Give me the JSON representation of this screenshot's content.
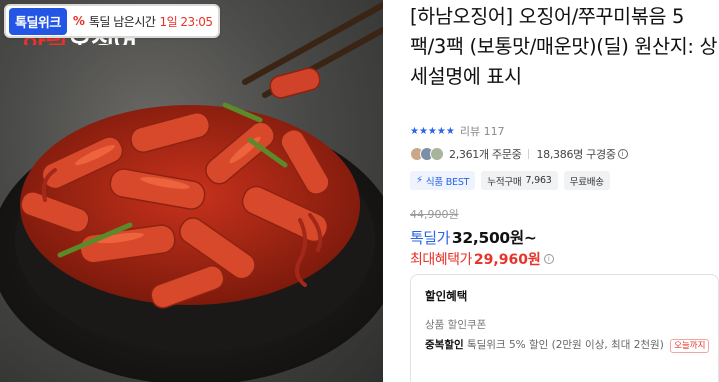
{
  "deal_banner": {
    "badge": "톡딜위크",
    "label": "톡딜 남은시간",
    "time": "1일 23:05",
    "percent_icon": "percent-icon"
  },
  "image_peek_text": {
    "red": "하남",
    "white": "오징어"
  },
  "product": {
    "title": "[하남오징어] 오징어/쭈꾸미볶음 5팩/3팩 (보통맛/매운맛)(딜) 원산지: 상세설명에 표시",
    "stars": "★★★★★",
    "reviews": "리뷰 117",
    "orders": "2,361개 주문중",
    "subscribers": "18,386명 구경중",
    "tags": {
      "best_label": "식품 BEST",
      "cumulative_label": "누적구매",
      "cumulative_value": "7,963",
      "shipping": "무료배송"
    }
  },
  "pricing": {
    "original": "44,900원",
    "deal_label": "톡딜가",
    "deal_value": "32,500원~",
    "max_benefit_label": "최대혜택가",
    "max_benefit_value": "29,960원"
  },
  "discount": {
    "title": "할인혜택",
    "coupon": "상품 할인쿠폰",
    "stack_label": "중복할인",
    "stack_text": "톡딜위크 5% 할인 (2만원 이상, 최대 2천원)",
    "today_badge": "오늘까지"
  },
  "colors": {
    "accent_blue": "#2a64e8",
    "accent_red": "#e8332b",
    "badge_blue": "#2456e6"
  }
}
